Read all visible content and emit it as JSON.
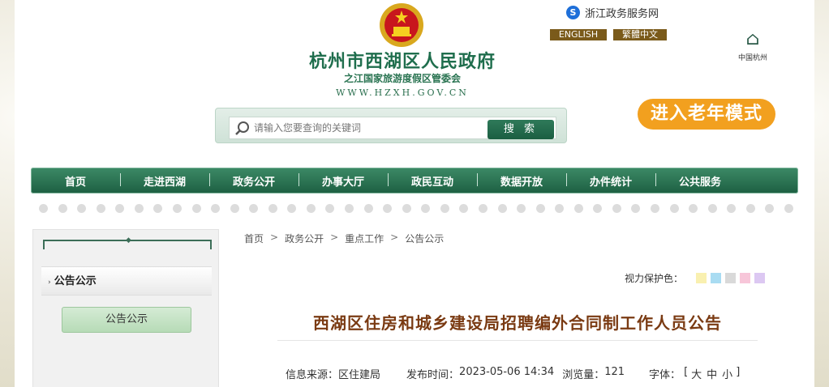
{
  "header": {
    "title": "杭州市西湖区人民政府",
    "subtitle": "之江国家旅游度假区管委会",
    "url": "WWW.HZXH.GOV.CN",
    "zj_link": "浙江政务服务网",
    "lang_en": "ENGLISH",
    "lang_tw": "繁體中文",
    "hz_logo_text": "中国杭州",
    "elder_mode": "进入老年模式"
  },
  "search": {
    "placeholder": "请输入您要查询的关键词",
    "button": "搜 索"
  },
  "nav": {
    "items": [
      "首页",
      "走进西湖",
      "政务公开",
      "办事大厅",
      "政民互动",
      "数据开放",
      "办件统计",
      "公共服务"
    ]
  },
  "sidebar": {
    "heading": "公告公示",
    "sub_item": "公告公示"
  },
  "breadcrumb": [
    "首页",
    "政务公开",
    "重点工作",
    "公告公示"
  ],
  "eye_protect": {
    "label": "视力保护色：",
    "colors": [
      "#f9f0b0",
      "#a9dcf2",
      "#d9d9d9",
      "#f7c6d9",
      "#dcc8f2"
    ]
  },
  "article": {
    "title": "西湖区住房和城乡建设局招聘编外合同制工作人员公告",
    "source_label": "信息来源：",
    "source": "区住建局",
    "date_label": "发布时间：",
    "date": "2023-05-06 14:34",
    "views_label": "浏览量：",
    "views": "121",
    "font_label": "字体：",
    "font_open": "[",
    "font_large": "大",
    "font_medium": "中",
    "font_small": "小",
    "font_close": "]"
  }
}
